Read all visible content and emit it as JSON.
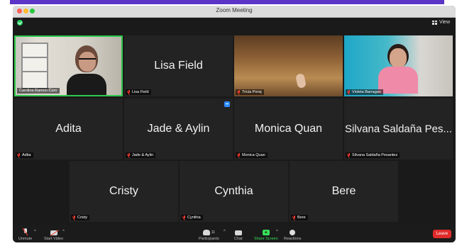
{
  "window": {
    "title": "Zoom Meeting",
    "view_label": "View"
  },
  "participants": [
    {
      "id": "carolina",
      "display_name": "",
      "label": "Carolina Ramon-Caro",
      "has_video": true,
      "muted": false,
      "active_speaker": true
    },
    {
      "id": "lisa",
      "display_name": "Lisa Field",
      "label": "Lisa Field",
      "has_video": false,
      "muted": true,
      "active_speaker": false
    },
    {
      "id": "tricia",
      "display_name": "",
      "label": "Tricia Poroj",
      "has_video": true,
      "muted": true,
      "active_speaker": false
    },
    {
      "id": "violeta",
      "display_name": "",
      "label": "Violeta Barragan",
      "has_video": true,
      "muted": true,
      "active_speaker": false
    },
    {
      "id": "adita",
      "display_name": "Adita",
      "label": "Adita",
      "has_video": false,
      "muted": true,
      "active_speaker": false
    },
    {
      "id": "jade",
      "display_name": "Jade & Aylin",
      "label": "Jade & Aylin",
      "has_video": false,
      "muted": true,
      "active_speaker": false,
      "badge": "screen-share"
    },
    {
      "id": "monica",
      "display_name": "Monica Quan",
      "label": "Monica Quan",
      "has_video": false,
      "muted": true,
      "active_speaker": false
    },
    {
      "id": "silvana",
      "display_name": "Silvana Saldaña Pes...",
      "label": "Silvana Saldaña Pesantez",
      "has_video": false,
      "muted": true,
      "active_speaker": false
    },
    {
      "id": "cristy",
      "display_name": "Cristy",
      "label": "Cristy",
      "has_video": false,
      "muted": true,
      "active_speaker": false
    },
    {
      "id": "cynthia",
      "display_name": "Cynthia",
      "label": "Cynthia",
      "has_video": false,
      "muted": true,
      "active_speaker": false
    },
    {
      "id": "bere",
      "display_name": "Bere",
      "label": "Bere",
      "has_video": false,
      "muted": true,
      "active_speaker": false
    }
  ],
  "toolbar": {
    "unmute": "Unmute",
    "start_video": "Start Video",
    "participants": "Participants",
    "participants_count": "11",
    "chat": "Chat",
    "share_screen": "Share Screen",
    "reactions": "Reactions",
    "leave": "Leave"
  },
  "colors": {
    "accent_green": "#2ec84a",
    "leave_red": "#e12b2b",
    "tile_bg": "#232323"
  }
}
